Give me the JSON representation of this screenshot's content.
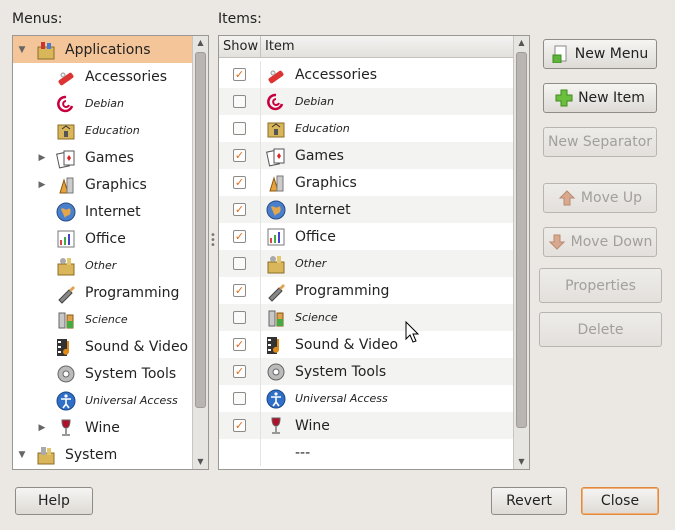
{
  "labels": {
    "menus": "Menus:",
    "items": "Items:"
  },
  "menus_tree": [
    {
      "label": "Applications",
      "icon": "applications-icon",
      "expanded": true,
      "selected": true,
      "level": 0
    },
    {
      "label": "Accessories",
      "icon": "accessories-icon",
      "level": 1
    },
    {
      "label": "Debian",
      "icon": "debian-icon",
      "level": 1,
      "small": true
    },
    {
      "label": "Education",
      "icon": "education-icon",
      "level": 1,
      "small": true
    },
    {
      "label": "Games",
      "icon": "games-icon",
      "level": 1,
      "expandable": true
    },
    {
      "label": "Graphics",
      "icon": "graphics-icon",
      "level": 1,
      "expandable": true
    },
    {
      "label": "Internet",
      "icon": "internet-icon",
      "level": 1
    },
    {
      "label": "Office",
      "icon": "office-icon",
      "level": 1
    },
    {
      "label": "Other",
      "icon": "other-icon",
      "level": 1,
      "small": true
    },
    {
      "label": "Programming",
      "icon": "programming-icon",
      "level": 1
    },
    {
      "label": "Science",
      "icon": "science-icon",
      "level": 1,
      "small": true
    },
    {
      "label": "Sound & Video",
      "icon": "sound-video-icon",
      "level": 1
    },
    {
      "label": "System Tools",
      "icon": "system-tools-icon",
      "level": 1
    },
    {
      "label": "Universal Access",
      "icon": "universal-access-icon",
      "level": 1,
      "small": true
    },
    {
      "label": "Wine",
      "icon": "wine-icon",
      "level": 1,
      "expandable": true
    },
    {
      "label": "System",
      "icon": "system-icon",
      "level": 0,
      "expanded": true
    }
  ],
  "items_table": {
    "headers": {
      "show": "Show",
      "item": "Item"
    },
    "rows": [
      {
        "label": "Accessories",
        "checked": true,
        "icon": "accessories-icon"
      },
      {
        "label": "Debian",
        "checked": false,
        "icon": "debian-icon",
        "small": true
      },
      {
        "label": "Education",
        "checked": false,
        "icon": "education-icon",
        "small": true
      },
      {
        "label": "Games",
        "checked": true,
        "icon": "games-icon"
      },
      {
        "label": "Graphics",
        "checked": true,
        "icon": "graphics-icon"
      },
      {
        "label": "Internet",
        "checked": true,
        "icon": "internet-icon"
      },
      {
        "label": "Office",
        "checked": true,
        "icon": "office-icon"
      },
      {
        "label": "Other",
        "checked": false,
        "icon": "other-icon",
        "small": true
      },
      {
        "label": "Programming",
        "checked": true,
        "icon": "programming-icon"
      },
      {
        "label": "Science",
        "checked": false,
        "icon": "science-icon",
        "small": true
      },
      {
        "label": "Sound & Video",
        "checked": true,
        "icon": "sound-video-icon"
      },
      {
        "label": "System Tools",
        "checked": true,
        "icon": "system-tools-icon"
      },
      {
        "label": "Universal Access",
        "checked": false,
        "icon": "universal-access-icon",
        "small": true
      },
      {
        "label": "Wine",
        "checked": true,
        "icon": "wine-icon"
      },
      {
        "label": "---",
        "separator": true
      }
    ]
  },
  "buttons": {
    "new_menu": "New Menu",
    "new_item": "New Item",
    "new_separator": "New Separator",
    "move_up": "Move Up",
    "move_down": "Move Down",
    "properties": "Properties",
    "delete": "Delete",
    "help": "Help",
    "revert": "Revert",
    "close": "Close"
  },
  "colors": {
    "selection": "#f5c59a",
    "window_bg": "#ebe8e4",
    "focus_border": "#e08a3f",
    "check_color": "#e06a1a"
  }
}
